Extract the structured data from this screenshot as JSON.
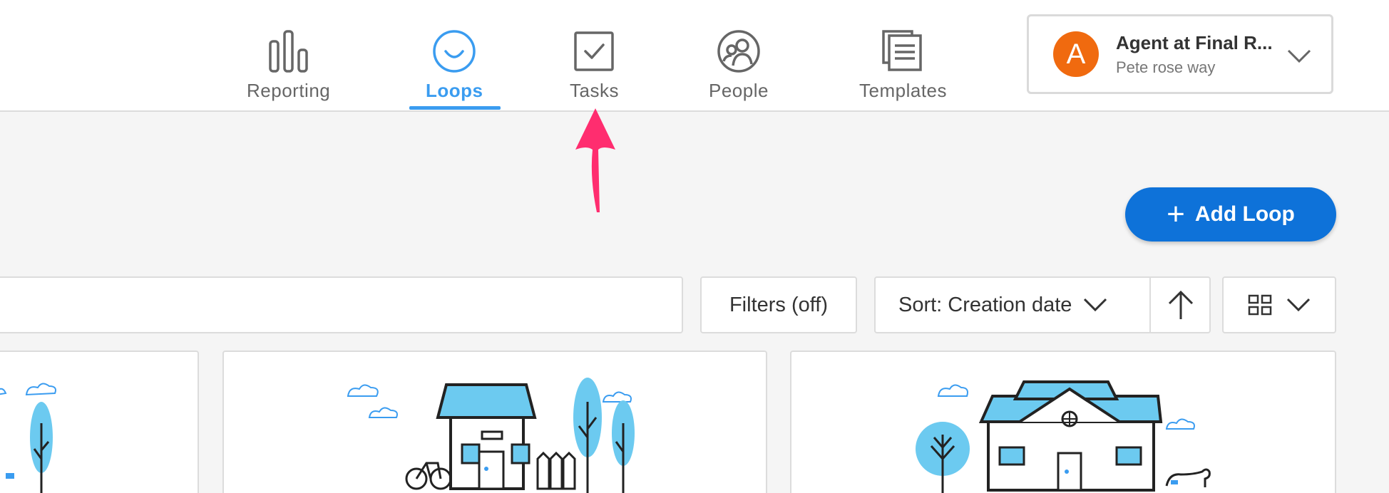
{
  "nav": {
    "items": [
      {
        "label": "Reporting",
        "icon": "bar-chart-icon"
      },
      {
        "label": "Loops",
        "icon": "smile-circle-icon",
        "active": true
      },
      {
        "label": "Tasks",
        "icon": "checkbox-icon"
      },
      {
        "label": "People",
        "icon": "people-icon"
      },
      {
        "label": "Templates",
        "icon": "documents-icon"
      }
    ]
  },
  "account": {
    "initial": "A",
    "name": "Agent at Final R...",
    "subtitle": "Pete rose way",
    "avatar_color": "#f06a0f"
  },
  "actions": {
    "add_loop_label": "Add Loop"
  },
  "toolbar": {
    "filters_label": "Filters (off)",
    "sort_label": "Sort: Creation date"
  },
  "colors": {
    "accent": "#3a9cf0",
    "primary_button": "#0e72d9",
    "illustration_blue": "#6ccaf0",
    "annotation_arrow": "#ff2d6f"
  }
}
